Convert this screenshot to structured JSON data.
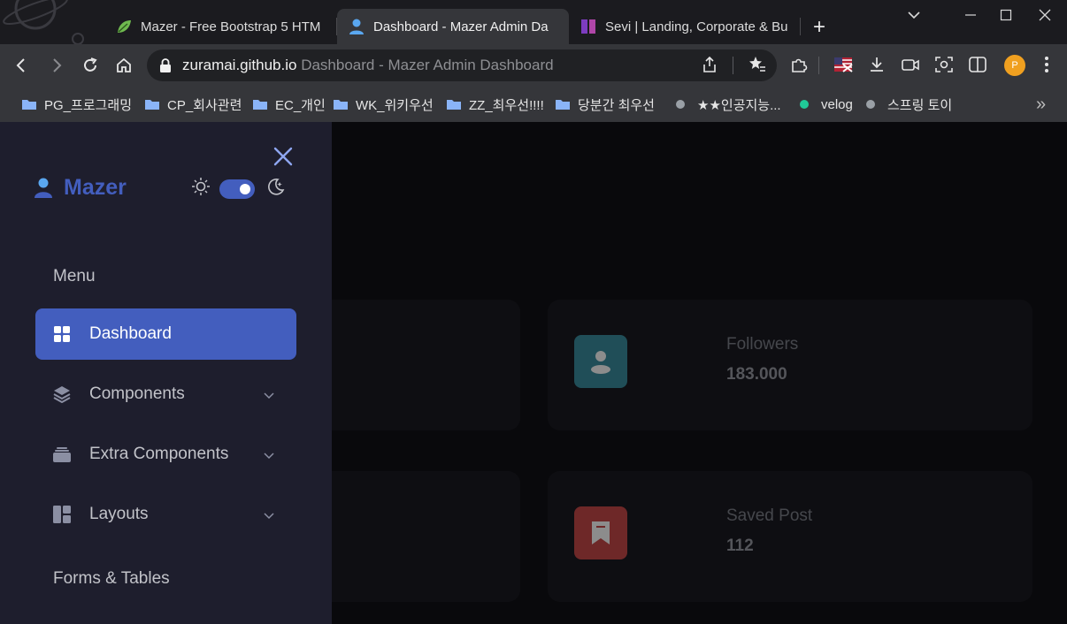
{
  "browser": {
    "tabs": [
      {
        "label": "Mazer - Free Bootstrap 5 HTM",
        "active": false,
        "icon": "leaf-favicon"
      },
      {
        "label": "Dashboard - Mazer Admin Da",
        "active": true,
        "icon": "user-favicon"
      },
      {
        "label": "Sevi | Landing, Corporate & Bu",
        "active": false,
        "icon": "sevi-favicon"
      }
    ],
    "new_tab": "+",
    "url_host": "zuramai.github.io",
    "url_title": "Dashboard - Mazer Admin Dashboard",
    "profile_initial": "P"
  },
  "bookmarks": [
    {
      "label": "PG_프로그래밍",
      "type": "folder"
    },
    {
      "label": "CP_회사관련",
      "type": "folder"
    },
    {
      "label": "EC_개인",
      "type": "folder"
    },
    {
      "label": "WK_위키우선",
      "type": "folder"
    },
    {
      "label": "ZZ_최우선!!!!",
      "type": "folder"
    },
    {
      "label": "당분간 최우선",
      "type": "folder"
    },
    {
      "label": "★★인공지능...",
      "type": "link",
      "dot_color": "#9aa0a6"
    },
    {
      "label": "velog",
      "type": "link",
      "dot_color": "#20c997"
    },
    {
      "label": "스프링 토이",
      "type": "link",
      "dot_color": "#9aa0a6"
    }
  ],
  "bookmarks_more": "»",
  "sidebar": {
    "logo": "Mazer",
    "menu_title": "Menu",
    "items": [
      {
        "label": "Dashboard",
        "icon": "grid-icon",
        "active": true
      },
      {
        "label": "Components",
        "icon": "stack-icon",
        "has_sub": true
      },
      {
        "label": "Extra Components",
        "icon": "collection-icon",
        "has_sub": true
      },
      {
        "label": "Layouts",
        "icon": "layout-icon",
        "has_sub": true
      }
    ],
    "next_item": "Forms & Tables",
    "theme_dark": true
  },
  "stats": [
    {
      "label": "Followers",
      "value": "183.000",
      "color": "#3b8fa0",
      "icon": "person-icon"
    },
    {
      "label": "Saved Post",
      "value": "112",
      "color": "#c94a4a",
      "icon": "bookmark-icon"
    }
  ],
  "colors": {
    "primary": "#435ebe",
    "sidebar_bg": "#1e1e2d",
    "page_bg": "#121217"
  }
}
